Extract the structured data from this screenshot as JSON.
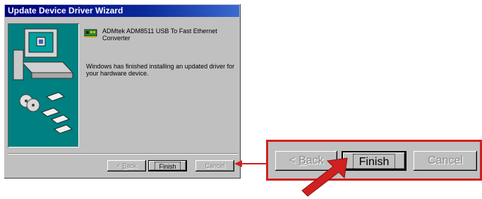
{
  "window": {
    "title": "Update Device Driver Wizard"
  },
  "device": {
    "name": "ADMtek ADM8511 USB To Fast Ethernet Converter",
    "icon": "network-adapter-icon"
  },
  "message": "Windows has finished installing an updated driver for your hardware device.",
  "buttons": {
    "back_prefix": "< ",
    "back_accel": "B",
    "back_rest": "ack",
    "finish": "Finish",
    "cancel": "Cancel"
  },
  "callout": {
    "buttons": {
      "back_prefix": "< ",
      "back_accel": "B",
      "back_rest": "ack",
      "finish": "Finish",
      "cancel": "Cancel"
    }
  },
  "colors": {
    "titlebar": "#000080",
    "dialog": "#c0c0c0",
    "art_bg": "#008080",
    "callout": "#d02020"
  }
}
